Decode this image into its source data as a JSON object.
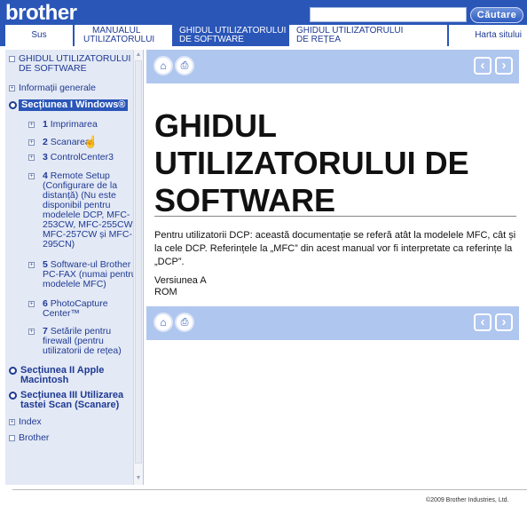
{
  "header": {
    "logo": "brother",
    "search_placeholder": "",
    "search_button": "Căutare"
  },
  "nav": {
    "tabs": [
      {
        "line1": "Sus",
        "line2": ""
      },
      {
        "line1": "MANUALUL",
        "line2": "UTILIZATORULUI"
      },
      {
        "line1": "GHIDUL UTILIZATORULUI",
        "line2": "DE SOFTWARE"
      },
      {
        "line1": "GHIDUL UTILIZATORULUI",
        "line2": "DE REȚEA"
      },
      {
        "line1": "Harta sitului",
        "line2": ""
      }
    ],
    "active_index": 2
  },
  "sidebar": {
    "items": [
      {
        "label": "GHIDUL UTILIZATORULUI DE SOFTWARE"
      },
      {
        "label": "Informații generale"
      },
      {
        "label": "Secțiunea I Windows®"
      },
      {
        "num": "1",
        "label": "Imprimarea"
      },
      {
        "num": "2",
        "label": "Scanarea"
      },
      {
        "num": "3",
        "label": "ControlCenter3"
      },
      {
        "num": "4",
        "label": "Remote Setup (Configurare de la distanță) (Nu este disponibil pentru modelele DCP, MFC-253CW, MFC-255CW, MFC-257CW și MFC-295CN)"
      },
      {
        "num": "5",
        "label": "Software-ul Brother PC-FAX (numai pentru modelele MFC)"
      },
      {
        "num": "6",
        "label": "PhotoCapture Center™"
      },
      {
        "num": "7",
        "label": "Setările pentru firewall (pentru utilizatorii de rețea)"
      },
      {
        "label": "Secțiunea II Apple Macintosh"
      },
      {
        "label": "Secțiunea III Utilizarea tastei Scan (Scanare)"
      },
      {
        "label": "Index"
      },
      {
        "label": "Brother"
      }
    ]
  },
  "main": {
    "title": "GHIDUL UTILIZATORULUI DE SOFTWARE",
    "body": "Pentru utilizatorii DCP: această documentație se referă atât la modelele MFC, cât și la cele DCP. Referințele la „MFC” din acest manual vor fi interpretate ca referințe la „DCP”.",
    "version_line1": "Versiunea A",
    "version_line2": "ROM"
  },
  "footer": {
    "copyright": "©2009 Brother Industries, Ltd."
  },
  "colors": {
    "brand_blue": "#2a56b8",
    "bar_blue": "#afc6ef",
    "sidebar_bg": "#e3e9f5",
    "link_text": "#1f3a93"
  }
}
